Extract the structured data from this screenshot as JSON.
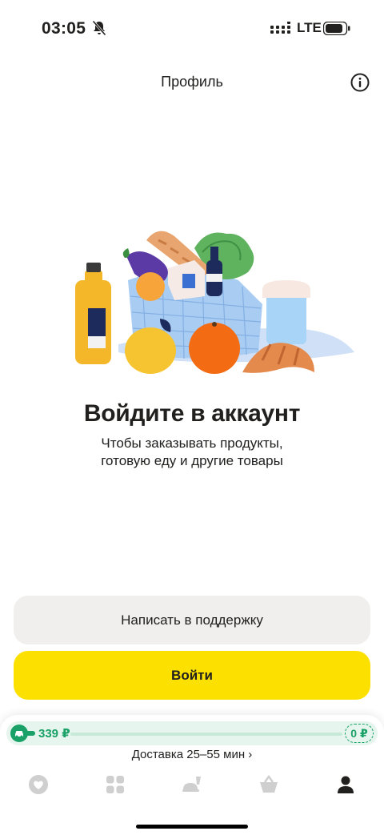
{
  "status_bar": {
    "time": "03:05",
    "network": "LTE"
  },
  "header": {
    "title": "Профиль"
  },
  "login": {
    "title": "Войдите в аккаунт",
    "subtitle_line1": "Чтобы заказывать продукты,",
    "subtitle_line2": "готовую еду и другие товары"
  },
  "buttons": {
    "support": "Написать в поддержку",
    "login": "Войти"
  },
  "delivery": {
    "min_amount": "339 ₽",
    "current_amount": "0 ₽",
    "time_text": "Доставка 25–55 мин ›"
  },
  "tabs": [
    {
      "name": "favorites",
      "icon": "heart-icon"
    },
    {
      "name": "catalog",
      "icon": "grid-icon"
    },
    {
      "name": "restaurants",
      "icon": "food-icon"
    },
    {
      "name": "cart",
      "icon": "basket-icon"
    },
    {
      "name": "profile",
      "icon": "profile-icon",
      "active": true
    }
  ],
  "colors": {
    "accent_yellow": "#fce000",
    "green": "#1aa167",
    "text": "#21201f",
    "gray_button": "#f0efed"
  }
}
